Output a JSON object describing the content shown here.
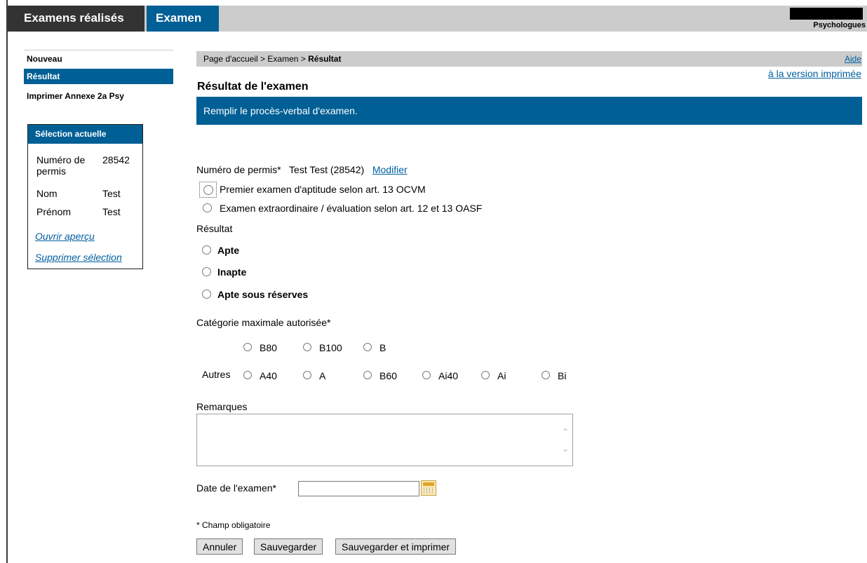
{
  "tabs": {
    "realised": "Examens réalisés",
    "exam": "Examen"
  },
  "role": "Psychologues",
  "nav": [
    {
      "label": "Nouveau"
    },
    {
      "label": "Résultat"
    },
    {
      "label": "Imprimer Annexe 2a Psy"
    }
  ],
  "selection": {
    "title": "Sélection actuelle",
    "permit_label": "Numéro de permis",
    "permit_value": "28542",
    "name_label": "Nom",
    "name_value": "Test",
    "firstname_label": "Prénom",
    "firstname_value": "Test",
    "open_preview": "Ouvrir aperçu",
    "delete_selection": "Supprimer sélection"
  },
  "breadcrumb": {
    "home": "Page d'accueil",
    "sep": ">",
    "exam": "Examen",
    "current": "Résultat"
  },
  "help": "Aide",
  "print_version": "à la version imprimée",
  "page_title": "Résultat de l'examen",
  "banner": "Remplir le procès-verbal d'examen.",
  "form": {
    "permit_label": "Numéro de permis*",
    "permit_value": "Test Test (28542)",
    "modify": "Modifier",
    "exam_type": [
      "Premier examen d'aptitude selon art. 13 OCVM",
      "Examen extraordinaire / évaluation selon art. 12 et 13 OASF"
    ],
    "result_label": "Résultat",
    "results": [
      "Apte",
      "Inapte",
      "Apte sous réserves"
    ],
    "category_label": "Catégorie maximale autorisée*",
    "categories_main": [
      "B80",
      "B100",
      "B"
    ],
    "others_label": "Autres",
    "categories_other": [
      "A40",
      "A",
      "B60",
      "Ai40",
      "Ai",
      "Bi"
    ],
    "remarks_label": "Remarques",
    "date_label": "Date de l'examen*",
    "date_value": "",
    "required_note": "* Champ obligatoire"
  },
  "buttons": {
    "cancel": "Annuler",
    "save": "Sauvegarder",
    "save_print": "Sauvegarder et imprimer"
  },
  "colors": {
    "accent": "#005f95",
    "dark": "#333333",
    "grey": "#cccccc",
    "link": "#0060a0"
  }
}
